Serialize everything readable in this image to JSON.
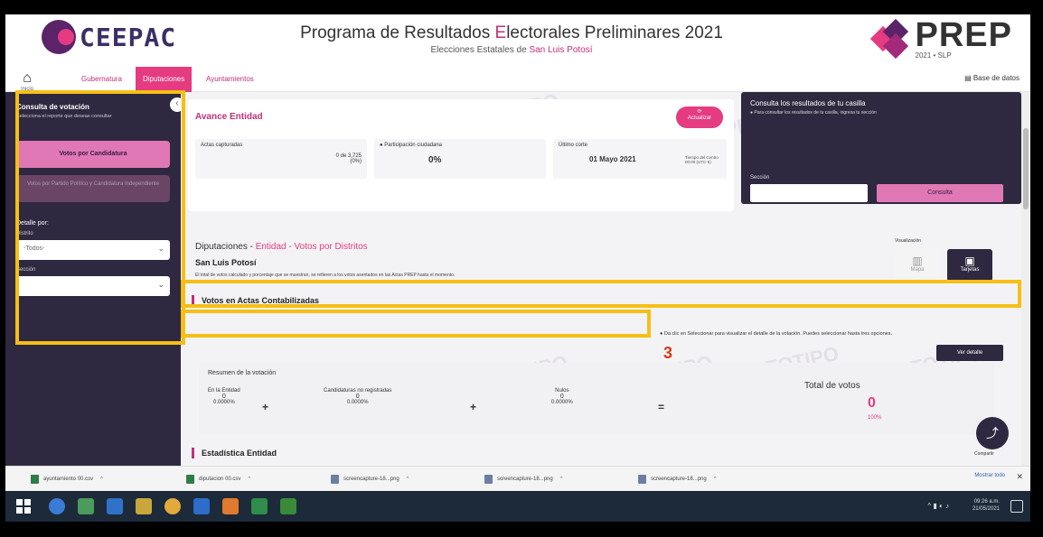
{
  "header": {
    "left_logo": "CEEPAC",
    "title_part1": "Programa de Resultados ",
    "title_highlight": "E",
    "title_part2": "lectorales Preliminares 2021",
    "subtitle_part1": "Elecciones Estatales de ",
    "subtitle_state": "San Luis Potosí",
    "right_logo": "PREP",
    "right_logo_sub": "2021 • SLP"
  },
  "nav": {
    "home_label": "Inicio",
    "tabs": [
      "Gubernatura",
      "Diputaciones",
      "Ayuntamientos"
    ],
    "active_tab": "Diputaciones",
    "database_label": "Base de datos"
  },
  "sidebar": {
    "title": "Consulta de votación",
    "subtitle": "Selecciona el reporte que deseas consultar",
    "btn_primary": "Votos por Candidatura",
    "btn_secondary": "Votos por Partido Político y Candidatura Independiente",
    "detail_label": "Detalle por:",
    "district_label": "Distrito",
    "district_value": "-Todos-",
    "section_label": "Sección",
    "section_value": ""
  },
  "avance": {
    "title": "Avance Entidad",
    "update_btn": "Actualizar",
    "actas_label": "Actas capturadas",
    "actas_value": "0 de 3,725",
    "actas_pct": "(0%)",
    "participacion_label": "Participación ciudadana",
    "participacion_value": "0%",
    "corte_label": "Último corte",
    "corte_value": "01 Mayo 2021",
    "corte_detail": "Tiempo del Centro 00:00 (UTC-5)"
  },
  "casilla": {
    "title": "Consulta los resultados de tu casilla",
    "subtitle": "Para consultar los resultados de tu casilla, ingresa tu sección",
    "section_label": "Sección",
    "search_btn": "Consulta"
  },
  "diputaciones": {
    "heading_main": "Diputaciones - ",
    "heading_entity": "Entidad",
    "heading_rest": " - Votos por Distritos",
    "state": "San Luis Potosí",
    "description": "El total de votos calculado y porcentaje que se muestran, se refieren a los votos asentados en las Actas PREP hasta el momento."
  },
  "visualizacion": {
    "label": "Visualización",
    "option1": "Mapa",
    "option2": "Tarjetas"
  },
  "votos_section": {
    "title": "Votos en Actas Contabilizadas",
    "info": "Da clic en Seleccionar para visualizar el detalle de la votación. Puedes seleccionar hasta tres opciones.",
    "info_highlight": "Seleccionar",
    "view_detail_btn": "Ver detalle"
  },
  "resumen": {
    "title": "Resumen de la votación",
    "col1_label": "En la Entidad",
    "col1_value": "0",
    "col1_pct": "0.0000%",
    "col2_label": "Candidaturas no registradas",
    "col2_value": "0",
    "col2_pct": "0.0000%",
    "col3_label": "Nulos",
    "col3_value": "0",
    "col3_pct": "0.0000%",
    "total_label": "Total de votos",
    "total_value": "0",
    "total_pct": "100%"
  },
  "share_label": "Compartir",
  "estadistica_title": "Estadística Entidad",
  "annotation": "3",
  "watermark": "PROTOTIPO",
  "downloads": {
    "items": [
      {
        "name": "ayuntamiento 00.csv",
        "type": "csv"
      },
      {
        "name": "diputacion 00.csv",
        "type": "csv"
      },
      {
        "name": "screencapture-18...png",
        "type": "img"
      },
      {
        "name": "screencapture-18...png",
        "type": "img"
      },
      {
        "name": "screencapture-18...png",
        "type": "img"
      }
    ],
    "show_all": "Mostrar todo"
  },
  "taskbar": {
    "time": "09:26 a.m.",
    "date": "21/05/2021"
  },
  "colors": {
    "accent": "#e43b81",
    "dark": "#2e2840",
    "highlight": "#f5bf16"
  }
}
